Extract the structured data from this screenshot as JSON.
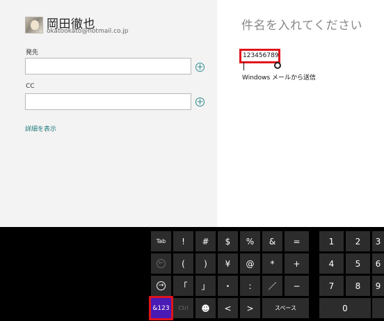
{
  "sender": {
    "name": "岡田徹也",
    "email": "okatookato@hotmail.co.jp"
  },
  "fields": {
    "to_label": "発先",
    "to_value": "",
    "cc_label": "CC",
    "cc_value": "",
    "add_icon": "+",
    "details_link": "詳細を表示"
  },
  "message": {
    "subject_placeholder": "件名を入れてください",
    "body_text": "123456789",
    "signature": "Windows メールから送信"
  },
  "keyboard": {
    "tab": "Tab",
    "back_arrow": "←",
    "enter_arrow": "→",
    "mode": "&123",
    "ctrl": "Ctrl",
    "emoji": "☻",
    "left": "<",
    "right": ">",
    "space": "スペース",
    "row1": [
      "!",
      "#",
      "$",
      "%",
      "&",
      "="
    ],
    "row2": [
      "(",
      ")",
      "¥",
      "@",
      "*",
      "+"
    ],
    "row3": [
      "「",
      "」",
      "・",
      ":",
      "／",
      "−"
    ],
    "numpad_row1": [
      "1",
      "2",
      "3"
    ],
    "numpad_row2": [
      "4",
      "5",
      "6"
    ],
    "numpad_row3": [
      "7",
      "8",
      "9"
    ],
    "zero": "0"
  },
  "colors": {
    "highlight": "#e0141b",
    "mode_key": "#4a1ab5",
    "link": "#1f7a7a"
  }
}
